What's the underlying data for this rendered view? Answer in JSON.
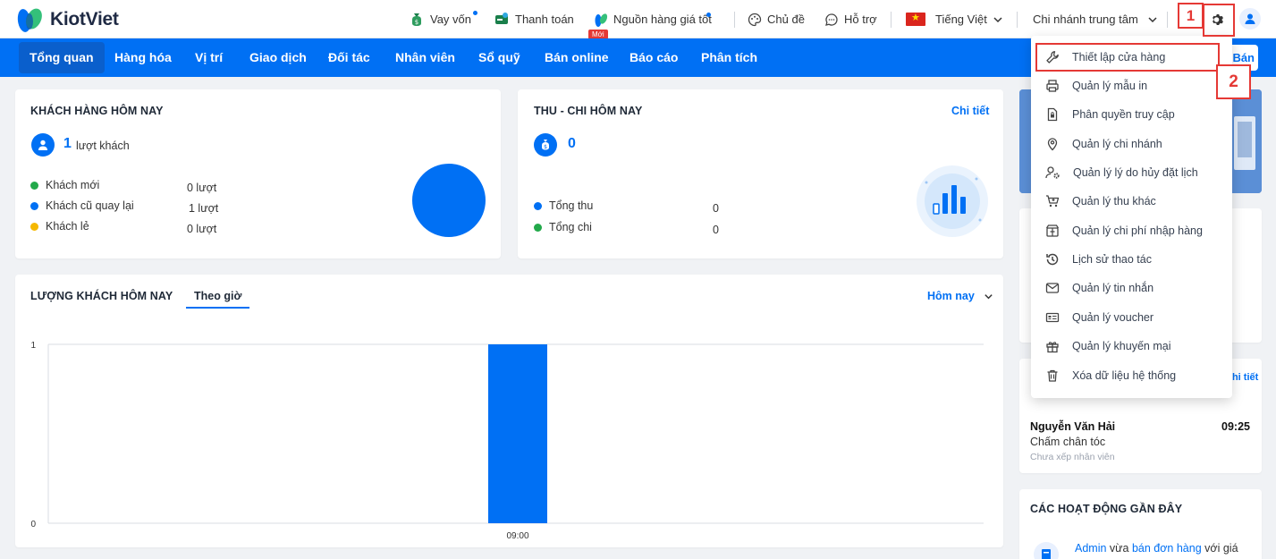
{
  "header": {
    "logo_text": "KiotViet",
    "items": {
      "loan": "Vay vốn",
      "payment": "Thanh toán",
      "supply": "Nguồn hàng giá tốt",
      "new_badge": "Mới",
      "theme": "Chủ đề",
      "support": "Hỗ trợ",
      "language": "Tiếng Việt",
      "branch": "Chi nhánh trung tâm"
    }
  },
  "nav": {
    "items": [
      "Tổng quan",
      "Hàng hóa",
      "Vị trí",
      "Giao dịch",
      "Đối tác",
      "Nhân viên",
      "Sổ quỹ",
      "Bán online",
      "Báo cáo",
      "Phân tích"
    ],
    "right_button": "Bán"
  },
  "customers_today": {
    "title": "KHÁCH HÀNG HÔM NAY",
    "count": "1",
    "count_unit": "lượt khách",
    "rows": [
      {
        "label": "Khách mới",
        "value": "0 lượt",
        "color": "#22a94a"
      },
      {
        "label": "Khách cũ quay lại",
        "value": "1 lượt",
        "color": "#0070f4"
      },
      {
        "label": "Khách lẻ",
        "value": "0 lượt",
        "color": "#f5b800"
      }
    ]
  },
  "cashflow_today": {
    "title": "THU - CHI HÔM NAY",
    "detail_link": "Chi tiết",
    "total": "0",
    "rows": [
      {
        "label": "Tổng thu",
        "value": "0",
        "color": "#0070f4"
      },
      {
        "label": "Tổng chi",
        "value": "0",
        "color": "#22a94a"
      }
    ]
  },
  "visits": {
    "title": "LƯỢNG KHÁCH HÔM NAY",
    "tab": "Theo giờ",
    "period": "Hôm nay"
  },
  "chart_data": {
    "type": "bar",
    "categories": [
      "09:00"
    ],
    "values": [
      1
    ],
    "ylim": [
      0,
      1
    ],
    "yticks": [
      "0",
      "1"
    ],
    "title": "",
    "xlabel": "",
    "ylabel": "",
    "color": "#0070f4",
    "grid": false
  },
  "side": {
    "booking_link": "Chi tiết",
    "booking": {
      "name": "Nguyễn Văn Hải",
      "time": "09:25",
      "service": "Chấm chân tóc",
      "staff": "Chưa xếp nhân viên"
    },
    "recent_title": "CÁC HOẠT ĐỘNG GẦN ĐÂY",
    "recent_text": {
      "user": "Admin",
      "mid": " vừa ",
      "action": "bán đơn hàng",
      "tail": " với giá"
    }
  },
  "settings_menu": {
    "items": [
      "Thiết lập cửa hàng",
      "Quản lý mẫu in",
      "Phân quyền truy cập",
      "Quản lý chi nhánh",
      "Quản lý lý do hủy đặt lịch",
      "Quản lý thu khác",
      "Quản lý chi phí nhập hàng",
      "Lịch sử thao tác",
      "Quản lý tin nhắn",
      "Quản lý voucher",
      "Quản lý khuyến mại",
      "Xóa dữ liệu hệ thống"
    ]
  },
  "annotations": {
    "step1": "1",
    "step2": "2"
  },
  "colors": {
    "primary": "#0070f4",
    "highlight": "#e53935"
  }
}
